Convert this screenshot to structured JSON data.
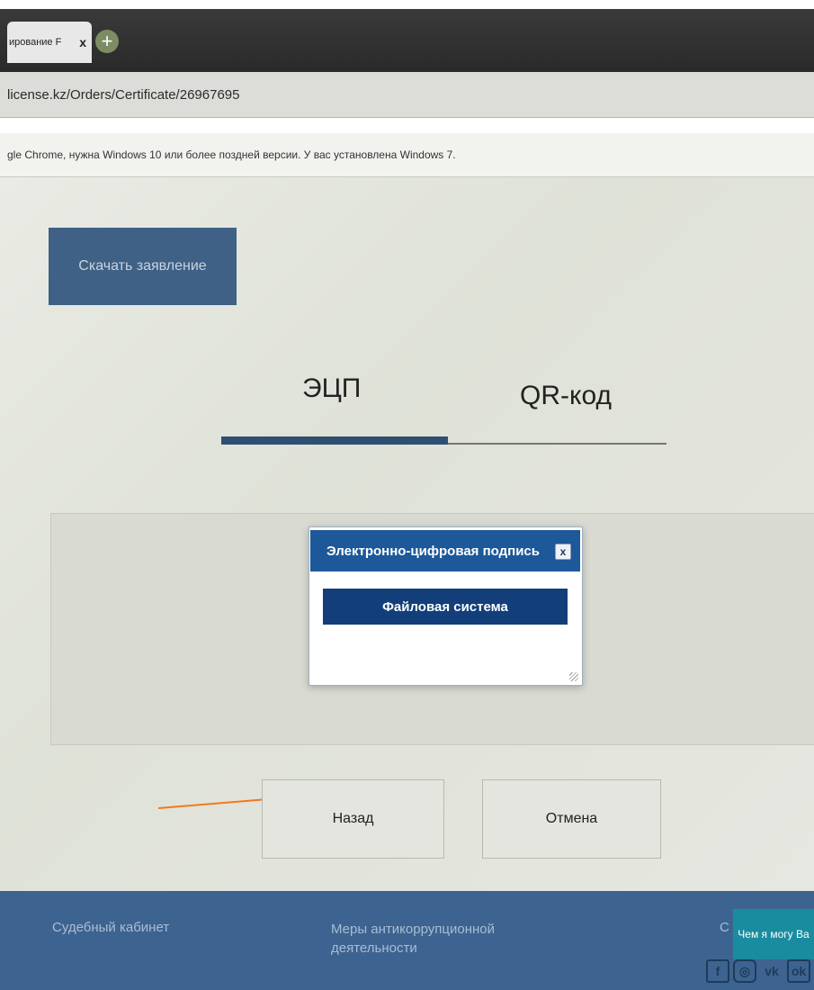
{
  "browser": {
    "tab_title": "ирование F",
    "tab_close": "x",
    "new_tab": "+",
    "url": "license.kz/Orders/Certificate/26967695",
    "info_message": "gle Chrome, нужна Windows 10 или более поздней версии. У вас установлена Windows 7."
  },
  "page": {
    "download_button": "Скачать заявление",
    "tabs": [
      {
        "label": "ЭЦП",
        "active": true
      },
      {
        "label": "QR-код",
        "active": false
      }
    ]
  },
  "dialog": {
    "title": "Электронно-цифровая подпись",
    "close": "x",
    "button": "Файловая система"
  },
  "buttons": {
    "back": "Назад",
    "cancel": "Отмена"
  },
  "footer": {
    "court_cabinet": "Судебный кабинет",
    "anticorruption": "Меры антикоррупционной деятельности",
    "help": "Чем я могу Ва",
    "partial_link": "С",
    "social": [
      "f",
      "◎",
      "vk",
      "ok"
    ]
  },
  "colors": {
    "primary": "#3e6185",
    "dialog_header": "#1d5899",
    "dialog_button": "#123f7a",
    "footer": "#3d6390",
    "help": "#1a8ca0",
    "annotation_arrow": "#f07a1e"
  }
}
